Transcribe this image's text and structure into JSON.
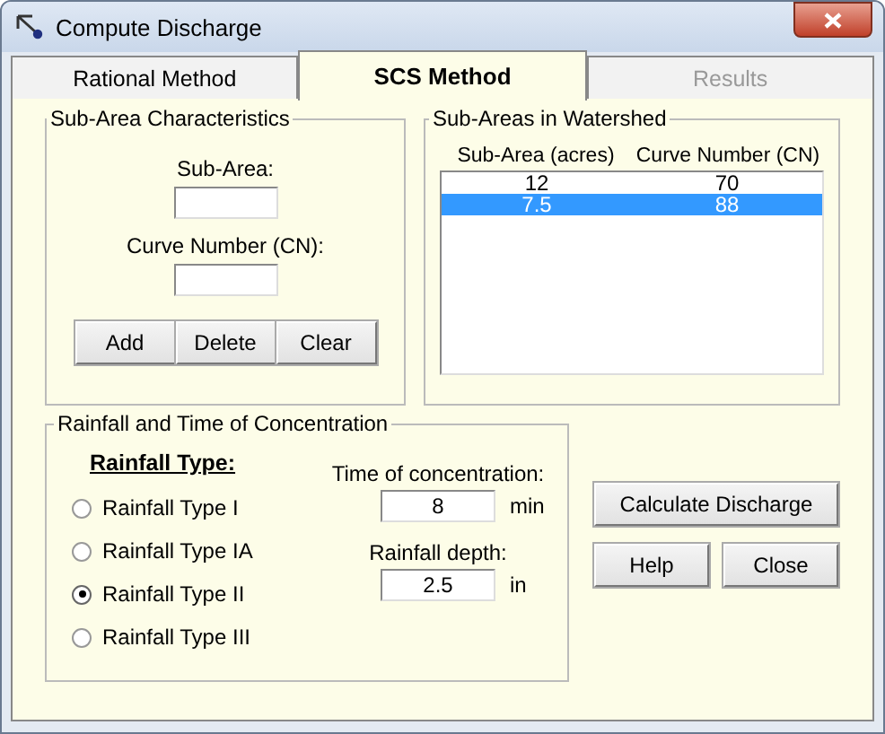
{
  "window": {
    "title": "Compute Discharge"
  },
  "tabs": [
    {
      "label": "Rational Method",
      "selected": false,
      "disabled": false
    },
    {
      "label": "SCS Method",
      "selected": true,
      "disabled": false
    },
    {
      "label": "Results",
      "selected": false,
      "disabled": true
    }
  ],
  "sub_area_characteristics": {
    "title": "Sub-Area Characteristics",
    "fields": [
      {
        "label": "Sub-Area:"
      },
      {
        "label": "Curve Number (CN):"
      }
    ],
    "buttons": [
      "Add",
      "Delete",
      "Clear"
    ]
  },
  "sub_areas_in_watershed": {
    "title": "Sub-Areas in Watershed",
    "columns": [
      "Sub-Area (acres)",
      "Curve Number (CN)"
    ],
    "rows": [
      {
        "cells": [
          "12",
          "70"
        ],
        "selected": false
      },
      {
        "cells": [
          "7.5",
          "88"
        ],
        "selected": true
      }
    ]
  },
  "rainfall_and_time_of_concentration": {
    "title": "Rainfall and Time of Concentration",
    "heading": "Rainfall Type:",
    "options": [
      {
        "label": "Rainfall Type I",
        "selected": false
      },
      {
        "label": "Rainfall Type IA",
        "selected": false
      },
      {
        "label": "Rainfall Type II",
        "selected": true
      },
      {
        "label": "Rainfall Type III",
        "selected": false
      }
    ],
    "fields": [
      {
        "label": "Time of concentration:",
        "value": "8",
        "unit": "min"
      },
      {
        "label": "Rainfall depth:",
        "value": "2.5",
        "unit": "in"
      }
    ]
  },
  "buttons": [
    {
      "label": "Calculate Discharge",
      "kind": "wide"
    },
    {
      "label": "Help",
      "kind": "small"
    },
    {
      "label": "Close",
      "kind": "small"
    }
  ]
}
